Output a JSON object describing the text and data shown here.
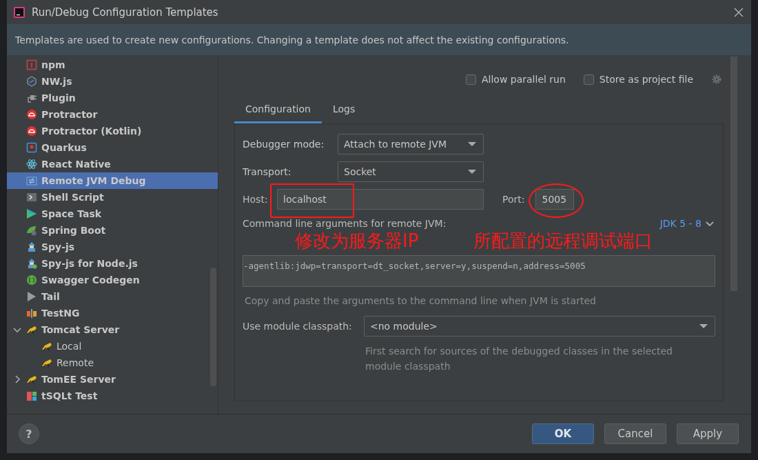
{
  "window": {
    "title": "Run/Debug Configuration Templates"
  },
  "banner": "Templates are used to create new configurations. Changing a template does not affect the existing configurations.",
  "sidebar": {
    "items": [
      {
        "label": "npm",
        "selected": false
      },
      {
        "label": "NW.js",
        "selected": false
      },
      {
        "label": "Plugin",
        "selected": false
      },
      {
        "label": "Protractor",
        "selected": false
      },
      {
        "label": "Protractor (Kotlin)",
        "selected": false
      },
      {
        "label": "Quarkus",
        "selected": false
      },
      {
        "label": "React Native",
        "selected": false
      },
      {
        "label": "Remote JVM Debug",
        "selected": true
      },
      {
        "label": "Shell Script",
        "selected": false
      },
      {
        "label": "Space Task",
        "selected": false
      },
      {
        "label": "Spring Boot",
        "selected": false
      },
      {
        "label": "Spy-js",
        "selected": false
      },
      {
        "label": "Spy-js for Node.js",
        "selected": false
      },
      {
        "label": "Swagger Codegen",
        "selected": false
      },
      {
        "label": "Tail",
        "selected": false
      },
      {
        "label": "TestNG",
        "selected": false
      },
      {
        "label": "Tomcat Server",
        "selected": false,
        "expanded": true,
        "children": [
          {
            "label": "Local",
            "selected": false
          },
          {
            "label": "Remote",
            "selected": false
          }
        ]
      },
      {
        "label": "TomEE Server",
        "selected": false,
        "expanded": false
      },
      {
        "label": "tSQLt Test",
        "selected": false
      }
    ]
  },
  "options": [
    {
      "label": "Allow parallel run",
      "checked": false
    },
    {
      "label": "Store as project file",
      "checked": false
    }
  ],
  "tabs": [
    {
      "label": "Configuration",
      "selected": true
    },
    {
      "label": "Logs",
      "selected": false
    }
  ],
  "form": {
    "debugger_mode": {
      "label": "Debugger mode:",
      "value": "Attach to remote JVM"
    },
    "transport": {
      "label": "Transport:",
      "value": "Socket"
    },
    "host": {
      "label": "Host:",
      "value": "localhost"
    },
    "port": {
      "label": "Port:",
      "value": "5005"
    },
    "command_line": {
      "label": "Command line arguments for remote JVM:",
      "jdk_link": "JDK 5 - 8",
      "value": "-agentlib:jdwp=transport=dt_socket,server=y,suspend=n,address=5005",
      "hint": "Copy and paste the arguments to the command line when JVM is started"
    },
    "module": {
      "label": "Use module classpath:",
      "value": "<no module>",
      "hint": "First search for sources of the debugged classes in the selected module classpath"
    }
  },
  "annotations": [
    {
      "kind": "box",
      "text": "修改为服务器IP"
    },
    {
      "kind": "ellipse",
      "text": "所配置的远程调试端口"
    }
  ],
  "help_button": "?",
  "buttons": [
    {
      "label": "OK",
      "primary": true
    },
    {
      "label": "Cancel",
      "primary": false
    },
    {
      "label": "Apply",
      "primary": false
    }
  ]
}
